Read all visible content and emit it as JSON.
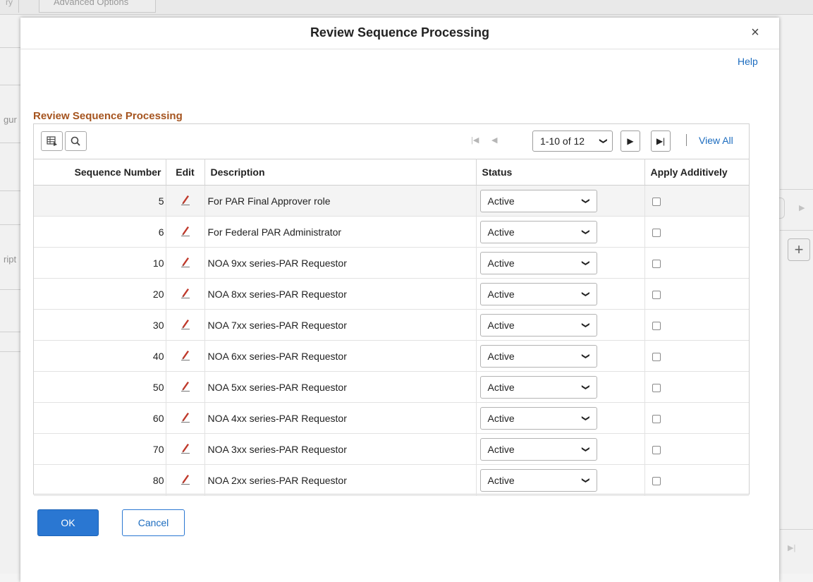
{
  "background": {
    "tab_stub": "ry",
    "tab_label": "Advanced Options",
    "fragment_1": "gur",
    "fragment_2": "ript",
    "add_button": "+"
  },
  "modal": {
    "title": "Review Sequence Processing",
    "close_label": "×",
    "help_label": "Help"
  },
  "section": {
    "title": "Review Sequence Processing"
  },
  "grid": {
    "pager": {
      "range": "1-10 of 12",
      "view_all": "View All"
    },
    "columns": {
      "sequence": "Sequence Number",
      "edit": "Edit",
      "description": "Description",
      "status": "Status",
      "apply": "Apply Additively"
    },
    "rows": [
      {
        "seq": "5",
        "description": "For PAR Final Approver role",
        "status": "Active"
      },
      {
        "seq": "6",
        "description": "For Federal PAR Administrator",
        "status": "Active"
      },
      {
        "seq": "10",
        "description": "NOA 9xx series-PAR Requestor",
        "status": "Active"
      },
      {
        "seq": "20",
        "description": "NOA 8xx series-PAR Requestor",
        "status": "Active"
      },
      {
        "seq": "30",
        "description": "NOA 7xx series-PAR Requestor",
        "status": "Active"
      },
      {
        "seq": "40",
        "description": "NOA 6xx series-PAR Requestor",
        "status": "Active"
      },
      {
        "seq": "50",
        "description": "NOA 5xx series-PAR Requestor",
        "status": "Active"
      },
      {
        "seq": "60",
        "description": "NOA 4xx series-PAR Requestor",
        "status": "Active"
      },
      {
        "seq": "70",
        "description": "NOA 3xx series-PAR Requestor",
        "status": "Active"
      },
      {
        "seq": "80",
        "description": "NOA 2xx series-PAR Requestor",
        "status": "Active"
      }
    ]
  },
  "buttons": {
    "ok": "OK",
    "cancel": "Cancel"
  },
  "colors": {
    "accent": "#2a77d2",
    "section_title": "#a5541f",
    "link": "#1c6cbf",
    "edit_icon": "#c0392b"
  }
}
